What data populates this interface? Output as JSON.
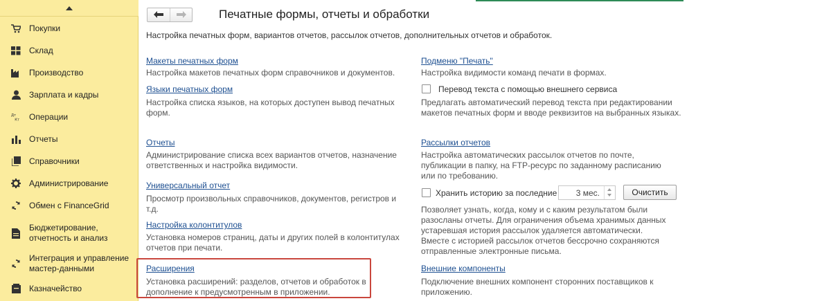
{
  "sidebar": {
    "items": [
      {
        "label": "Покупки",
        "icon": "cart-icon"
      },
      {
        "label": "Склад",
        "icon": "warehouse-icon"
      },
      {
        "label": "Производство",
        "icon": "factory-icon"
      },
      {
        "label": "Зарплата и кадры",
        "icon": "person-icon"
      },
      {
        "label": "Операции",
        "icon": "dt-kt-icon",
        "icon_text": "Дт Кт"
      },
      {
        "label": "Отчеты",
        "icon": "bar-chart-icon"
      },
      {
        "label": "Справочники",
        "icon": "books-icon"
      },
      {
        "label": "Администрирование",
        "icon": "gear-icon"
      },
      {
        "label": "Обмен с FinanceGrid",
        "icon": "sync-icon"
      },
      {
        "label": "Бюджетирование, отчетность и анализ",
        "icon": "budget-icon"
      },
      {
        "label": "Интеграция и управление мастер-данными",
        "icon": "integration-icon"
      },
      {
        "label": "Казначейство",
        "icon": "treasury-icon"
      }
    ]
  },
  "header": {
    "title": "Печатные формы, отчеты и обработки",
    "subtitle": "Настройка печатных форм, вариантов отчетов, рассылок отчетов, дополнительных отчетов и обработок."
  },
  "left_column": [
    {
      "link": "Макеты печатных форм",
      "desc": "Настройка макетов печатных форм справочников и документов."
    },
    {
      "link": "Языки печатных форм",
      "desc": "Настройка списка языков, на которых доступен вывод печатных форм."
    },
    {
      "link": "Отчеты",
      "desc": "Администрирование списка всех вариантов отчетов, назначение ответственных и настройка видимости."
    },
    {
      "link": "Универсальный отчет",
      "desc": "Просмотр произвольных справочников, документов, регистров и т.д."
    },
    {
      "link": "Настройка колонтитулов",
      "desc": "Установка номеров страниц, даты и других полей в колонтитулах отчетов при печати."
    },
    {
      "link": "Расширения",
      "desc": "Установка расширений: разделов, отчетов и обработок в дополнение к предусмотренным в приложении."
    }
  ],
  "right_column": {
    "print_submenu": {
      "link": "Подменю \"Печать\"",
      "desc": "Настройка видимости команд печати в формах."
    },
    "translation": {
      "label": "Перевод текста с помощью внешнего сервиса",
      "checked": false,
      "desc": "Предлагать автоматический перевод текста при редактировании макетов печатных форм и вводе реквизитов на выбранных языках."
    },
    "mailings": {
      "link": "Рассылки отчетов",
      "desc": "Настройка автоматических рассылок отчетов по почте, публикации в папку, на FTP-ресурс по заданному расписанию или по требованию."
    },
    "history": {
      "label": "Хранить историю за последние",
      "checked": false,
      "value": "3 мес.",
      "button": "Очистить",
      "desc": "Позволяет узнать, когда, кому и с каким результатом были разосланы отчеты. Для ограничения объема хранимых данных устаревшая история рассылок удаляется автоматически. Вместе с историей рассылок отчетов бессрочно сохраняются отправленные электронные письма."
    },
    "external": {
      "link": "Внешние компоненты",
      "desc": "Подключение внешних компонент сторонних поставщиков к приложению."
    }
  },
  "colors": {
    "sidebar_bg": "#fbec9e",
    "link": "#1d4f91",
    "highlight": "#c9463d"
  }
}
